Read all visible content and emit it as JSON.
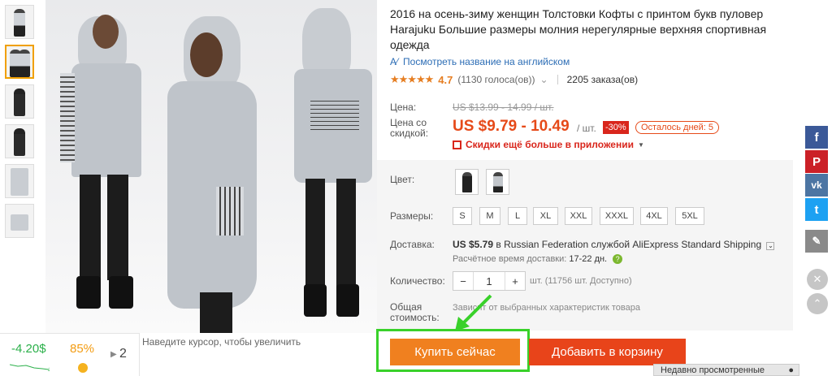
{
  "product": {
    "title": "2016 на осень-зиму женщин Толстовки Кофты с принтом букв пуловер Harajuku Большие размеры молния нерегулярные верхняя спортивная одежда",
    "translate_link": "Посмотреть название на английском",
    "rating": {
      "stars": "★★★★★",
      "score": "4.7",
      "votes": "(1130 голоса(ов))",
      "orders": "2205 заказа(ов)"
    }
  },
  "pricing": {
    "price_label": "Цена:",
    "old_price": "US $13.99 - 14.99 / шт.",
    "discount_label": "Цена со скидкой:",
    "price": "US $9.79 - 10.49",
    "unit": "/ шт.",
    "discount": "-30%",
    "days_left": "Осталось дней: 5",
    "app_promo": "Скидки ещё больше в приложении"
  },
  "options": {
    "color_label": "Цвет:",
    "size_label": "Размеры:",
    "sizes": [
      "S",
      "M",
      "L",
      "XL",
      "XXL",
      "XXXL",
      "4XL",
      "5XL"
    ],
    "shipping_label": "Доставка:",
    "shipping_cost": "US $5.79",
    "shipping_text": "в Russian Federation службой AliExpress Standard Shipping",
    "eta_label": "Расчётное время доставки:",
    "eta_value": "17-22 дн.",
    "qty_label": "Количество:",
    "qty_value": "1",
    "qty_minus": "−",
    "qty_plus": "+",
    "availability": "шт. (11756 шт. Доступно)",
    "total_label": "Общая стоимость:",
    "total_value": "Зависит от выбранных характеристик товара"
  },
  "buttons": {
    "buy": "Купить сейчас",
    "cart": "Добавить в корзину"
  },
  "image_hint": "Наведите курсор, чтобы увеличить",
  "widget": {
    "price": "-4.20$",
    "percent": "85%",
    "count": "2"
  },
  "recently_viewed": "Недавно просмотренные",
  "social": [
    "facebook-icon",
    "pinterest-icon",
    "vk-icon",
    "twitter-icon",
    "edit-icon",
    "close-icon",
    "scroll-up-icon"
  ],
  "colors": {
    "accent": "#f0801f",
    "cart": "#e8441a",
    "price": "#e64a19",
    "highlight": "#39d12a"
  }
}
